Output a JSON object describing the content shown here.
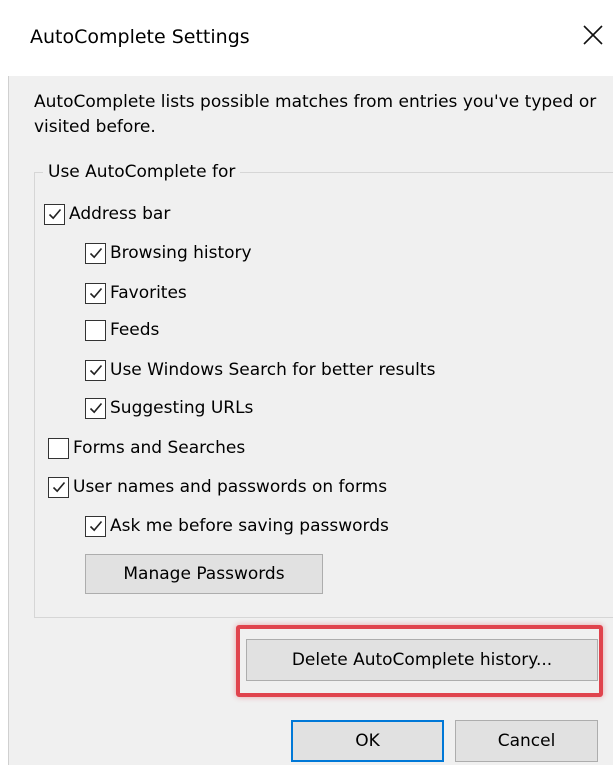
{
  "window": {
    "title": "AutoComplete Settings"
  },
  "description": "AutoComplete lists possible matches from entries you've typed or visited before.",
  "group": {
    "label": "Use AutoComplete for",
    "options": {
      "address_bar": {
        "label": "Address bar",
        "checked": true
      },
      "browsing_history": {
        "label": "Browsing history",
        "checked": true
      },
      "favorites": {
        "label": "Favorites",
        "checked": true
      },
      "feeds": {
        "label": "Feeds",
        "checked": false
      },
      "windows_search": {
        "label": "Use Windows Search for better results",
        "checked": true
      },
      "suggesting_urls": {
        "label": "Suggesting URLs",
        "checked": true
      },
      "forms_searches": {
        "label": "Forms and Searches",
        "checked": false
      },
      "usernames_passwords": {
        "label": "User names and passwords on forms",
        "checked": true
      },
      "ask_before_saving": {
        "label": "Ask me before saving passwords",
        "checked": true
      }
    },
    "manage_passwords_label": "Manage Passwords"
  },
  "buttons": {
    "delete_history": "Delete AutoComplete history...",
    "ok": "OK",
    "cancel": "Cancel"
  },
  "colors": {
    "highlight": "#e0434d",
    "default_button_border": "#0078d7",
    "dialog_background": "#f0f0f0"
  },
  "icons": {
    "close": "close-icon",
    "check": "checkmark-icon"
  }
}
